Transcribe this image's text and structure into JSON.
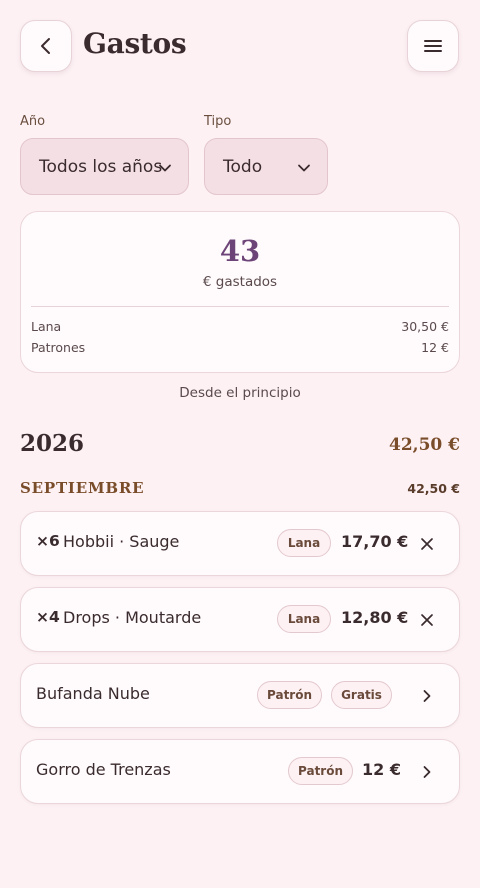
{
  "header": {
    "title": "Gastos",
    "back_icon": "chevron-left-icon",
    "menu_icon": "hamburger-icon"
  },
  "filters": {
    "year_label": "Año",
    "year_value": "Todos los años",
    "type_label": "Tipo",
    "type_value": "Todo"
  },
  "summary": {
    "total": "43",
    "total_label": "€ gastados",
    "breakdown": [
      {
        "label": "Lana",
        "value": "30,50 €"
      },
      {
        "label": "Patrones",
        "value": "12 €"
      }
    ],
    "since_label": "Desde el principio"
  },
  "year_section": {
    "year": "2026",
    "year_total": "42,50 €",
    "month": "SEPTIEMBRE",
    "month_total": "42,50 €"
  },
  "entries": [
    {
      "qty": "×6",
      "name": "Hobbii · Sauge",
      "chips": [
        "Lana"
      ],
      "amount": "17,70 €",
      "action": "close-icon"
    },
    {
      "qty": "×4",
      "name": "Drops · Moutarde",
      "chips": [
        "Lana"
      ],
      "amount": "12,80 €",
      "action": "close-icon"
    },
    {
      "qty": "",
      "name": "Bufanda Nube",
      "chips": [
        "Patrón",
        "Gratis"
      ],
      "amount": "",
      "action": "chevron-right-icon"
    },
    {
      "qty": "",
      "name": "Gorro de Trenzas",
      "chips": [
        "Patrón"
      ],
      "amount": "12 €",
      "action": "chevron-right-icon"
    }
  ],
  "colors": {
    "background": "#fdf1f4",
    "card": "#fffafb",
    "accent_total": "#6d4478",
    "brown": "#7a4d2a",
    "select_bg": "#f4dfe4"
  }
}
